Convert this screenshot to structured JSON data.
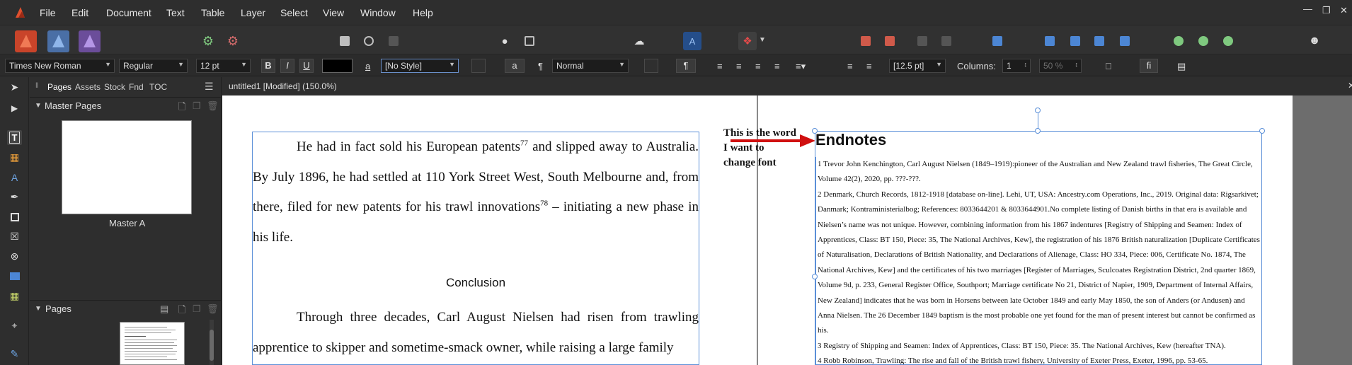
{
  "menubar": {
    "items": [
      "File",
      "Edit",
      "Document",
      "Text",
      "Table",
      "Layer",
      "Select",
      "View",
      "Window",
      "Help"
    ],
    "window_controls": [
      "minimize-icon",
      "restore-icon",
      "close-icon"
    ]
  },
  "context_toolbar": {
    "font_family": "Times New Roman",
    "font_style": "Regular",
    "font_size": "12 pt",
    "bold": "B",
    "italic": "I",
    "underline": "U",
    "text_color": "#000000",
    "char_style_glyph": "a",
    "char_style": "[No Style]",
    "para_glyph": "¶",
    "para_style": "Normal",
    "para_glyph2": "¶",
    "leading": "[12.5 pt]",
    "columns_label": "Columns:",
    "columns_value": "1",
    "gutter": "50 %",
    "ligature_glyph": "fi"
  },
  "panel": {
    "tabs": [
      "Pages",
      "Assets",
      "Stock",
      "Fnd",
      "TOC"
    ],
    "master_pages_title": "Master Pages",
    "master_name": "Master A",
    "pages_title": "Pages"
  },
  "document": {
    "tab_title": "untitled1 [Modified] (150.0%)"
  },
  "left_page": {
    "para1_a": "He had in fact sold his European patents",
    "sup1": "77",
    "para1_b": " and slipped away to Australia. By July 1896, he had settled at 110 York Street West, South Melbourne and, from there, filed for new patents for his trawl innovations",
    "sup2": "78",
    "para1_c": " – initiating a new phase in his life.",
    "heading": "Conclusion",
    "para2": "Through three decades, Carl August Nielsen had risen from trawling apprentice to skipper and sometime-smack owner, while raising a large family"
  },
  "annotation": {
    "line1": "This is the word",
    "line2": "I want to",
    "line3": "change font"
  },
  "right_page": {
    "title": "Endnotes",
    "notes": [
      {
        "num": "1",
        "text": " Trevor John Kenchington, Carl August Nielsen (1849–1919):pioneer of the Australian and New Zealand trawl fisheries, The Great Circle, Volume 42(2), 2020, pp. ???-???."
      },
      {
        "num": "2",
        "text": " Denmark, Church Records, 1812-1918 [database on-line]. Lehi, UT, USA: Ancestry.com Operations, Inc., 2019. Original data: Rigsarkivet; Danmark; Kontraministerialbog; References: 8033644201 & 8033644901.No complete listing of Danish births in that era is available and Nielsen’s name was not unique. However, combining information from his 1867 indentures [Registry of Shipping and Seamen: Index of Apprentices, Class: BT 150, Piece: 35, The National Archives, Kew], the registration of his 1876 British naturalization [Duplicate Certificates of Naturalisation, Declarations of British Nationality, and Declarations of Alienage, Class: HO 334, Piece: 006, Certificate No. 1874, The National Archives, Kew] and the certificates of his two marriages [Register of Marriages, Sculcoates Registration District, 2nd quarter 1869, Volume 9d, p. 233, General Register Office, Southport; Marriage certificate No 21, District of Napier, 1909, Department of Internal Affairs, New Zealand] indicates that he was born in Horsens between late October 1849 and early May 1850, the son of Anders (or Andusen) and Anna Nielsen. The 26 December 1849 baptism is the most probable one yet found for the man of present interest but cannot be confirmed as his."
      },
      {
        "num": "3",
        "text": " Registry of Shipping and Seamen: Index of Apprentices, Class: BT 150, Piece: 35. The National Archives, Kew (hereafter TNA)."
      },
      {
        "num": "4",
        "text": " Robb Robinson, Trawling: The rise and fall of the British trawl fishery, University of Exeter Press, Exeter, 1996, pp. 53-65."
      }
    ]
  }
}
